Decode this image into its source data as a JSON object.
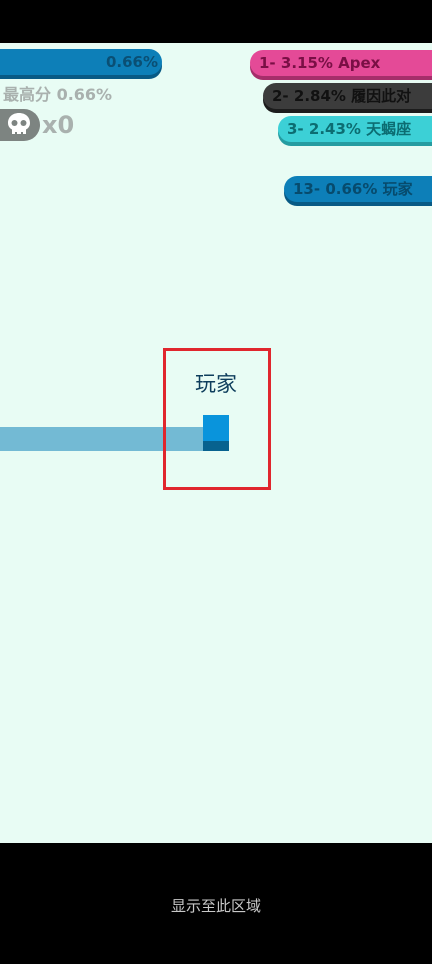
{
  "hud": {
    "progress": "0.66%",
    "progress_value": 0.66,
    "best_score": "最高分 0.66%",
    "kills": "x0"
  },
  "leaderboard": [
    {
      "text": "1- 3.15% Apex",
      "color": "#e44a97"
    },
    {
      "text": "2- 2.84% 履因此对",
      "color": "#3c3c3c"
    },
    {
      "text": "3- 2.43% 天蝎座",
      "color": "#3cd0d6"
    }
  ],
  "my_rank": {
    "text": "13- 0.66% 玩家",
    "color": "#0d7fb8"
  },
  "player": {
    "name": "玩家",
    "color": "#0994dc",
    "trail_color": "#73bad4"
  },
  "footer": {
    "hint": "显示至此区域"
  },
  "colors": {
    "background": "#e8fcf4",
    "highlight": "#e0262d"
  },
  "icons": [
    "skull-icon"
  ]
}
